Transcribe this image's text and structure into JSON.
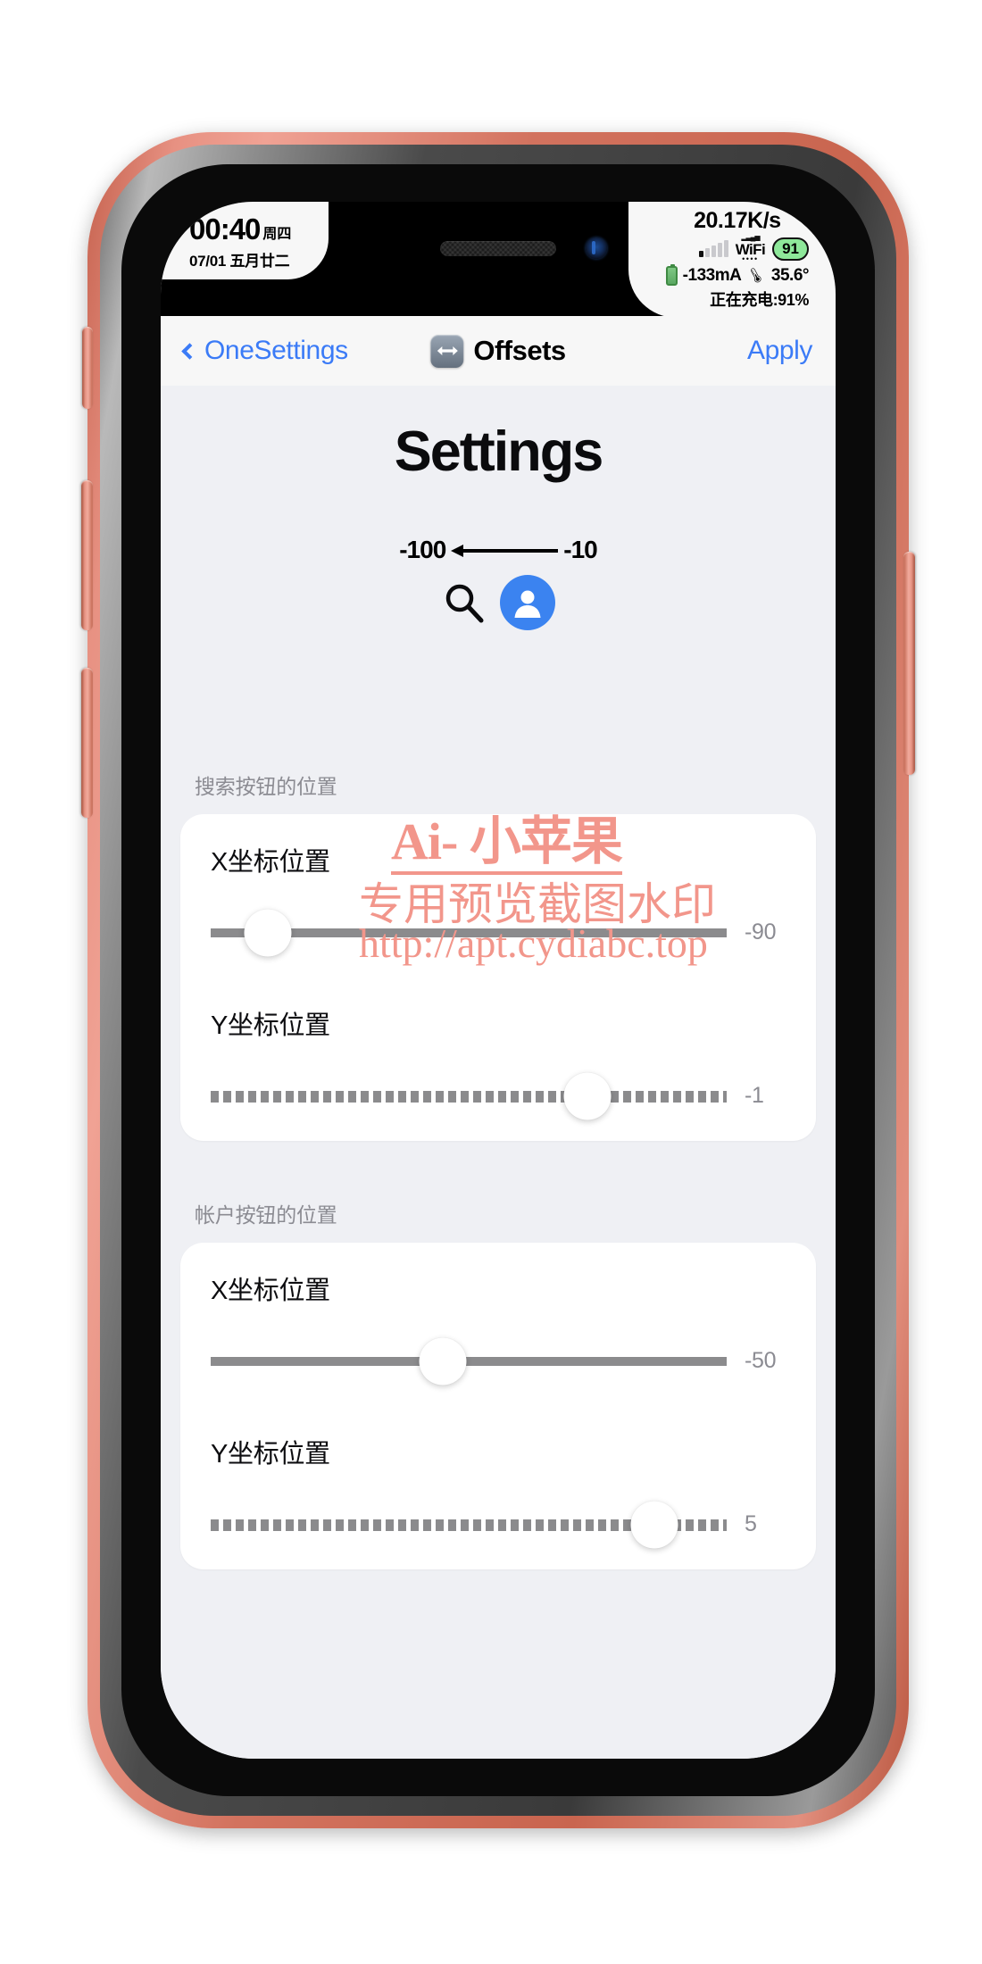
{
  "status_bar": {
    "time": "00:40",
    "weekday": "周四",
    "date": "07/01 五月廿二",
    "network_speed": "20.17K/s",
    "wifi_caption": "WiFi",
    "wifi_dots": "••••",
    "battery_percent_pill": "91",
    "current_ma": "-133mA",
    "temperature": "35.6°",
    "charging_text": "正在充电:91%",
    "signal_bars_active": 1,
    "signal_bars_total": 5
  },
  "nav": {
    "back_label": "OneSettings",
    "title": "Offsets",
    "title_icon": "left-right-arrow-icon",
    "apply_label": "Apply",
    "accent_color": "#3b7bf7"
  },
  "preview": {
    "heading": "Settings",
    "annotation_left": "-100",
    "annotation_right": "-10",
    "annotation_arrow": "left-arrow-icon",
    "search_icon": "search-icon",
    "account_icon": "account-avatar-icon",
    "account_icon_color": "#3b83f0"
  },
  "sections": [
    {
      "header": "搜索按钮的位置",
      "rows": [
        {
          "label": "X坐标位置",
          "value": "-90",
          "thumb_pct": 11,
          "track_style": "solid"
        },
        {
          "label": "Y坐标位置",
          "value": "-1",
          "thumb_pct": 73,
          "track_style": "dashed"
        }
      ]
    },
    {
      "header": "帐户按钮的位置",
      "rows": [
        {
          "label": "X坐标位置",
          "value": "-50",
          "thumb_pct": 45,
          "track_style": "solid"
        },
        {
          "label": "Y坐标位置",
          "value": "5",
          "thumb_pct": 86,
          "track_style": "dashed"
        }
      ]
    }
  ],
  "watermark": {
    "line1": "Ai- 小苹果",
    "line2": "专用预览截图水印",
    "line3": "http://apt.cydiabc.top",
    "color": "#f2968b"
  }
}
